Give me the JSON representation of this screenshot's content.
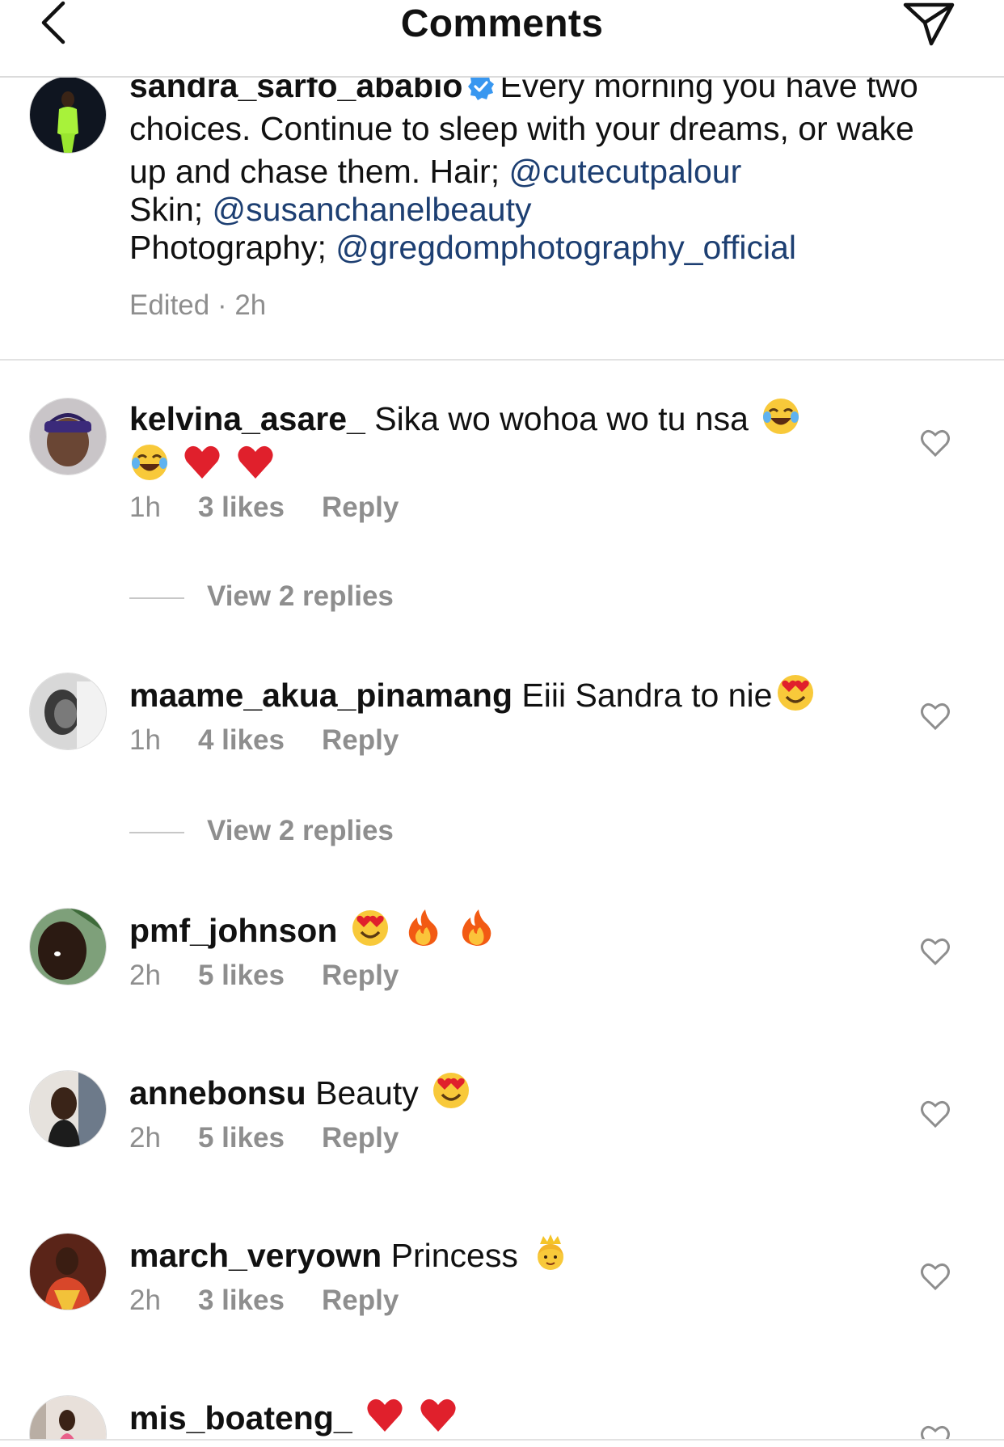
{
  "header": {
    "title": "Comments"
  },
  "caption": {
    "username": "sandra_sarfo_ababio",
    "text_1": "Every morning you have two",
    "text_2": "choices. Continue to sleep with your dreams, or wake",
    "text_3": "up and chase them.  Hair; ",
    "mention_1": "@cutecutpalour",
    "text_4": "Skin; ",
    "mention_2": "@susanchanelbeauty",
    "text_5": "Photography; ",
    "mention_3": "@gregdomphotography_official",
    "meta": "Edited · 2h"
  },
  "comments": [
    {
      "username": "kelvina_asare_",
      "text": "Sika wo wohoa wo tu nsa",
      "emojis": [
        "joy",
        "joy",
        "heart",
        "heart"
      ],
      "time": "1h",
      "likes": "3 likes",
      "reply": "Reply",
      "view_replies": "View 2 replies"
    },
    {
      "username": "maame_akua_pinamang",
      "text": "Eiii Sandra to nie",
      "emojis": [
        "heart-eyes"
      ],
      "time": "1h",
      "likes": "4 likes",
      "reply": "Reply",
      "view_replies": "View 2 replies"
    },
    {
      "username": "pmf_johnson",
      "text": "",
      "emojis": [
        "heart-eyes",
        "fire",
        "fire"
      ],
      "time": "2h",
      "likes": "5 likes",
      "reply": "Reply"
    },
    {
      "username": "annebonsu",
      "text": "Beauty",
      "emojis": [
        "heart-eyes"
      ],
      "time": "2h",
      "likes": "5 likes",
      "reply": "Reply"
    },
    {
      "username": "march_veryown",
      "text": "Princess",
      "emojis": [
        "princess"
      ],
      "time": "2h",
      "likes": "3 likes",
      "reply": "Reply"
    },
    {
      "username": "mis_boateng_",
      "text": "",
      "emojis": [
        "heart",
        "heart"
      ]
    }
  ],
  "colors": {
    "mention": "#1d3f72",
    "muted": "#8e8e8e",
    "verified": "#3897f0"
  }
}
